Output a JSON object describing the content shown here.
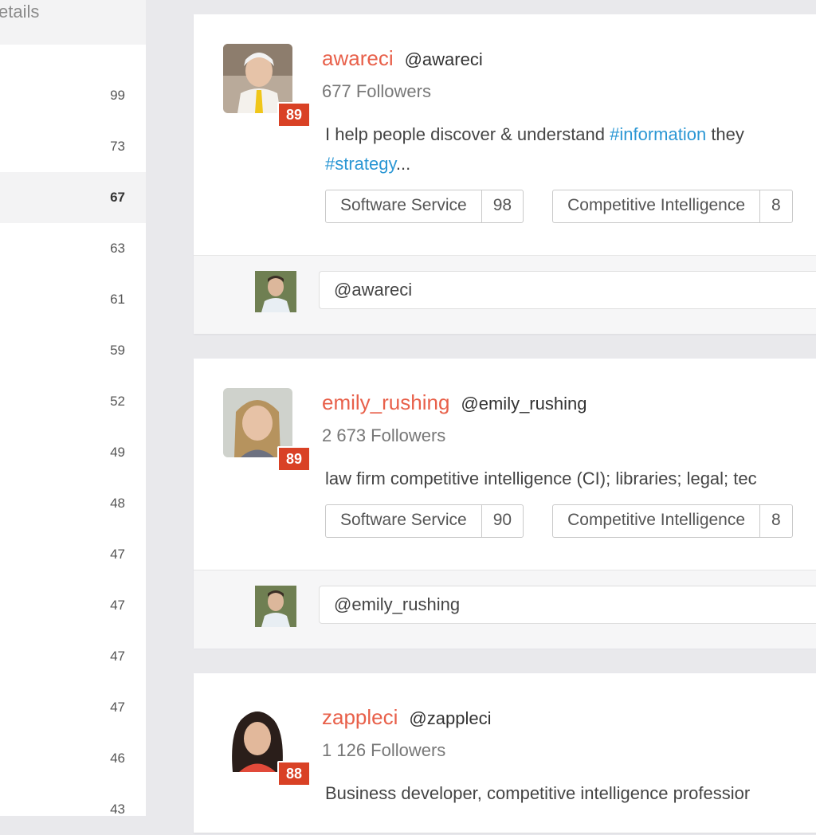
{
  "sidebar": {
    "header": "etails",
    "counts": [
      "99",
      "73",
      "67",
      "63",
      "61",
      "59",
      "52",
      "49",
      "48",
      "47",
      "47",
      "47",
      "47",
      "46",
      "43"
    ],
    "active_index": 2
  },
  "cards": [
    {
      "name": "awareci",
      "handle": "@awareci",
      "followers": "677 Followers",
      "score": "89",
      "bio_line1_pre": "I help people discover & understand ",
      "bio_line1_tag": "#information",
      "bio_line1_post": " they",
      "bio_line2_tag": "#strategy",
      "bio_line2_post": "...",
      "tags": [
        {
          "label": "Software Service",
          "score": "98"
        },
        {
          "label": "Competitive Intelligence",
          "score": "8"
        }
      ],
      "reply_value": "@awareci"
    },
    {
      "name": "emily_rushing",
      "handle": "@emily_rushing",
      "followers": "2 673 Followers",
      "score": "89",
      "bio": "law firm competitive intelligence (CI); libraries; legal; tec",
      "tags": [
        {
          "label": "Software Service",
          "score": "90"
        },
        {
          "label": "Competitive Intelligence",
          "score": "8"
        }
      ],
      "reply_value": "@emily_rushing"
    },
    {
      "name": "zappleci",
      "handle": "@zappleci",
      "followers": "1 126 Followers",
      "score": "88",
      "bio": "Business developer, competitive intelligence professior"
    }
  ],
  "colors": {
    "name": "#e8604a",
    "hashtag": "#2b97d4",
    "score_badge": "#d94125"
  }
}
